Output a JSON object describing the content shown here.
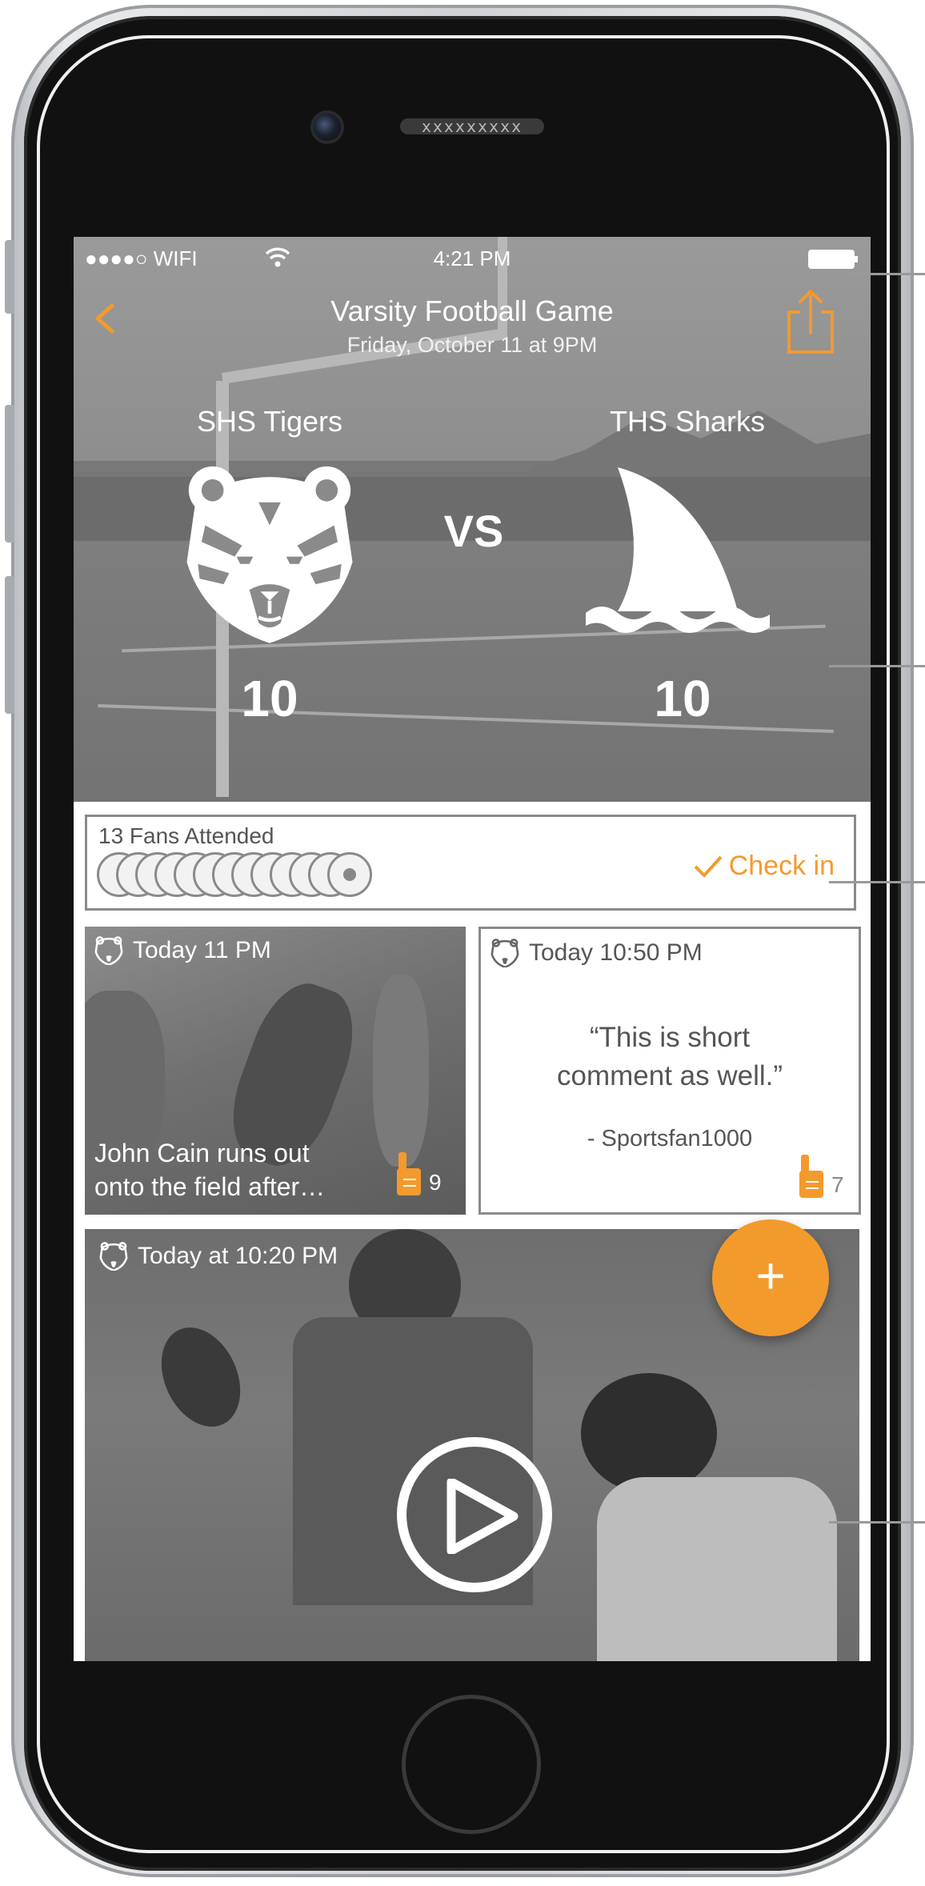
{
  "device": {
    "speaker_text": "xxxxxxxxx"
  },
  "status_bar": {
    "carrier": "●●●●○ WIFI",
    "time": "4:21 PM"
  },
  "header": {
    "title": "Varsity Football Game",
    "subtitle": "Friday, October 11 at 9PM"
  },
  "matchup": {
    "home": {
      "name": "SHS Tigers",
      "score": "10",
      "logo": "tiger-icon"
    },
    "away": {
      "name": "THS Sharks",
      "score": "10",
      "logo": "shark-fin-icon"
    },
    "vs_label": "VS"
  },
  "fans": {
    "label": "13 Fans Attended",
    "avatar_count": 13,
    "checkin_label": "Check in"
  },
  "feed": [
    {
      "type": "photo",
      "time": "Today 11 PM",
      "caption_line1": "John Cain runs out",
      "caption_line2": "onto the field after…",
      "likes": "9"
    },
    {
      "type": "comment",
      "time": "Today 10:50 PM",
      "quote_line1": "“This is short",
      "quote_line2": "comment as well.”",
      "author": "- Sportsfan1000",
      "likes": "7"
    },
    {
      "type": "video",
      "time": "Today at 10:20 PM"
    }
  ],
  "fab": {
    "label": "+"
  },
  "colors": {
    "accent": "#f39a2d",
    "text_light": "#ffffff",
    "border": "#8a8a8a"
  }
}
